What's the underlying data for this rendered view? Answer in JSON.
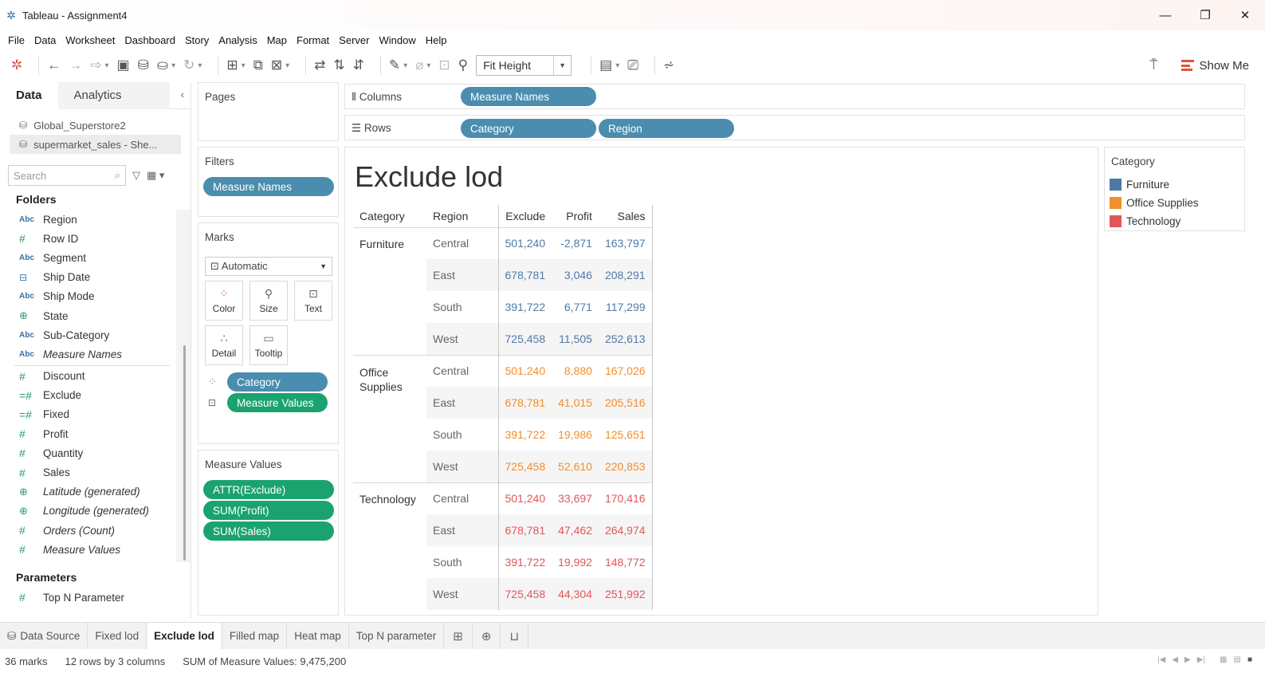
{
  "window": {
    "title": "Tableau - Assignment4",
    "controls": {
      "minimize": "—",
      "restore": "❐",
      "close": "✕"
    }
  },
  "menu": [
    "File",
    "Data",
    "Worksheet",
    "Dashboard",
    "Story",
    "Analysis",
    "Map",
    "Format",
    "Server",
    "Window",
    "Help"
  ],
  "toolbar": {
    "fit": "Fit Height",
    "show_me": "Show Me"
  },
  "datapane": {
    "tabs": {
      "data": "Data",
      "analytics": "Analytics"
    },
    "sources": [
      "Global_Superstore2",
      "supermarket_sales - She..."
    ],
    "search_placeholder": "Search",
    "folders_title": "Folders",
    "dimensions": [
      {
        "type": "Abc",
        "name": "Region"
      },
      {
        "type": "#",
        "name": "Row ID"
      },
      {
        "type": "Abc",
        "name": "Segment"
      },
      {
        "type": "date",
        "name": "Ship Date"
      },
      {
        "type": "Abc",
        "name": "Ship Mode"
      },
      {
        "type": "geo",
        "name": "State"
      },
      {
        "type": "Abc",
        "name": "Sub-Category"
      },
      {
        "type": "Abc",
        "name": "Measure Names",
        "italic": true
      }
    ],
    "measures": [
      {
        "type": "#",
        "name": "Discount"
      },
      {
        "type": "=#",
        "name": "Exclude"
      },
      {
        "type": "=#",
        "name": "Fixed"
      },
      {
        "type": "#",
        "name": "Profit"
      },
      {
        "type": "#",
        "name": "Quantity"
      },
      {
        "type": "#",
        "name": "Sales"
      },
      {
        "type": "geo",
        "name": "Latitude (generated)",
        "italic": true
      },
      {
        "type": "geo",
        "name": "Longitude (generated)",
        "italic": true
      },
      {
        "type": "#",
        "name": "Orders (Count)",
        "italic": true
      },
      {
        "type": "#",
        "name": "Measure Values",
        "italic": true
      }
    ],
    "parameters_title": "Parameters",
    "parameters": [
      {
        "type": "#",
        "name": "Top N Parameter"
      }
    ]
  },
  "shelves": {
    "pages": "Pages",
    "columns_label": "Columns",
    "rows_label": "Rows",
    "columns": [
      "Measure Names"
    ],
    "rows": [
      "Category",
      "Region"
    ],
    "filters": "Filters",
    "filter_pills": [
      "Measure Names"
    ],
    "marks": "Marks",
    "mark_type": "Automatic",
    "mark_cards": [
      "Color",
      "Size",
      "Text",
      "Detail",
      "Tooltip"
    ],
    "mark_pills": [
      "Category",
      "Measure Values"
    ],
    "measure_values": "Measure Values",
    "mv_pills": [
      "ATTR(Exclude)",
      "SUM(Profit)",
      "SUM(Sales)"
    ]
  },
  "view": {
    "title": "Exclude lod",
    "headers": [
      "Category",
      "Region",
      "Exclude",
      "Profit",
      "Sales"
    ],
    "colors": {
      "Furniture": "#4e79a7",
      "Office Supplies": "#f28e2b",
      "Technology": "#e15759"
    },
    "groups": [
      {
        "category": "Furniture",
        "rows": [
          {
            "region": "Central",
            "exclude": "501,240",
            "profit": "-2,871",
            "sales": "163,797"
          },
          {
            "region": "East",
            "exclude": "678,781",
            "profit": "3,046",
            "sales": "208,291"
          },
          {
            "region": "South",
            "exclude": "391,722",
            "profit": "6,771",
            "sales": "117,299"
          },
          {
            "region": "West",
            "exclude": "725,458",
            "profit": "11,505",
            "sales": "252,613"
          }
        ]
      },
      {
        "category": "Office Supplies",
        "rows": [
          {
            "region": "Central",
            "exclude": "501,240",
            "profit": "8,880",
            "sales": "167,026"
          },
          {
            "region": "East",
            "exclude": "678,781",
            "profit": "41,015",
            "sales": "205,516"
          },
          {
            "region": "South",
            "exclude": "391,722",
            "profit": "19,986",
            "sales": "125,651"
          },
          {
            "region": "West",
            "exclude": "725,458",
            "profit": "52,610",
            "sales": "220,853"
          }
        ]
      },
      {
        "category": "Technology",
        "rows": [
          {
            "region": "Central",
            "exclude": "501,240",
            "profit": "33,697",
            "sales": "170,416"
          },
          {
            "region": "East",
            "exclude": "678,781",
            "profit": "47,462",
            "sales": "264,974"
          },
          {
            "region": "South",
            "exclude": "391,722",
            "profit": "19,992",
            "sales": "148,772"
          },
          {
            "region": "West",
            "exclude": "725,458",
            "profit": "44,304",
            "sales": "251,992"
          }
        ]
      }
    ]
  },
  "legend": {
    "title": "Category",
    "items": [
      {
        "label": "Furniture",
        "color": "#4e79a7"
      },
      {
        "label": "Office Supplies",
        "color": "#f28e2b"
      },
      {
        "label": "Technology",
        "color": "#e15759"
      }
    ]
  },
  "sheet_tabs": {
    "data_source": "Data Source",
    "sheets": [
      "Fixed lod",
      "Exclude lod",
      "Filled map",
      "Heat map",
      "Top N parameter"
    ],
    "active": "Exclude lod"
  },
  "status": {
    "marks": "36 marks",
    "dims": "12 rows by 3 columns",
    "sum": "SUM of Measure Values: 9,475,200"
  }
}
